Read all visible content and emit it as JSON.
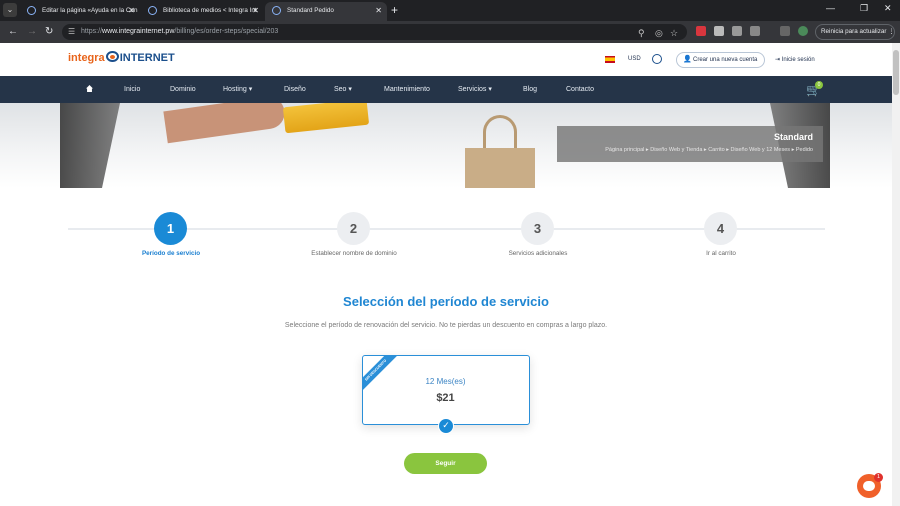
{
  "browser": {
    "tabs": [
      {
        "title": "Editar la página «Ayuda en la Con"
      },
      {
        "title": "Biblioteca de medios < Integra Int"
      },
      {
        "title": "Standard Pedido"
      }
    ],
    "url_prefix": "https://",
    "url_host": "www.integrainternet.pw",
    "url_path": "/billing/es/order-steps/special/203",
    "update_button": "Reinicia para actualizar"
  },
  "site": {
    "logo_part1": "integra",
    "logo_part2": "INTERNET",
    "currency": "USD",
    "create_account": "Crear una nueva cuenta",
    "login": "Inicie sesión",
    "cart_count": "0",
    "nav": [
      "Inicio",
      "Dominio",
      "Hosting",
      "Diseño",
      "Seo",
      "Mantenimiento",
      "Servicios",
      "Blog",
      "Contacto"
    ],
    "nav_dropdown_marker": "▾"
  },
  "hero": {
    "title": "Standard",
    "breadcrumb": "Página principal  ▸  Diseño Web y Tienda  ▸  Carrito  ▸  Diseño Web y 12 Meses  ▸  Pedido"
  },
  "steps": [
    {
      "number": "1",
      "label": "Período de servicio"
    },
    {
      "number": "2",
      "label": "Establecer nombre de dominio"
    },
    {
      "number": "3",
      "label": "Servicios adicionales"
    },
    {
      "number": "4",
      "label": "Ir al carrito"
    }
  ],
  "main": {
    "title": "Selección del período de servicio",
    "subtitle": "Seleccione el período de renovación del servicio. No te pierdas un descuento en compras a largo plazo.",
    "period_ribbon": "SIN DESCUENTO",
    "period_name": "12 Mes(es)",
    "period_price": "$21",
    "next_button": "Seguir"
  },
  "chat": {
    "badge": "1"
  },
  "colors": {
    "accent": "#1a8ad6",
    "nav_bg": "#253448",
    "button_green": "#8ac53e",
    "brand_orange": "#e8641b"
  }
}
